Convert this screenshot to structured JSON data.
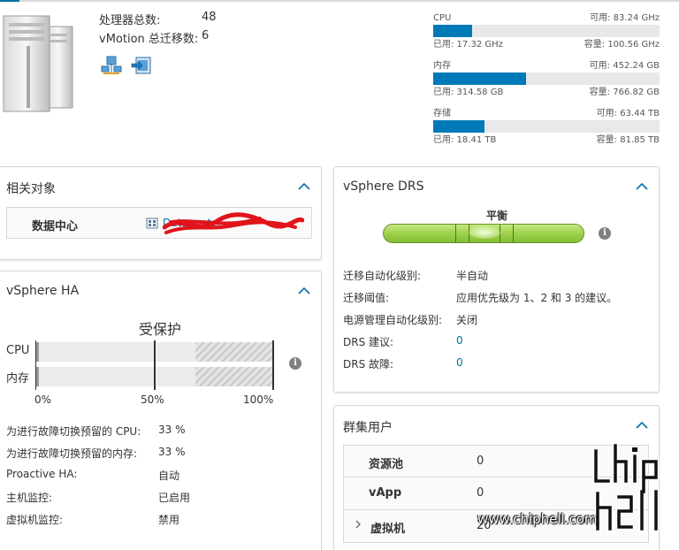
{
  "header": {
    "stats": [
      {
        "label": "处理器总数:",
        "value": "48"
      },
      {
        "label": "vMotion 总迁移数:",
        "value": "6"
      }
    ],
    "icons": [
      "network-icon",
      "migrate-icon"
    ]
  },
  "resources": [
    {
      "name": "CPU",
      "free": "可用: 83.24 GHz",
      "used": "已用: 17.32 GHz",
      "capacity": "容量: 100.56 GHz",
      "used_fraction": 0.172
    },
    {
      "name": "内存",
      "free": "可用: 452.24 GB",
      "used": "已用: 314.58 GB",
      "capacity": "容量: 766.82 GB",
      "used_fraction": 0.41
    },
    {
      "name": "存储",
      "free": "可用: 63.44 TB",
      "used": "已用: 18.41 TB",
      "capacity": "容量: 81.85 TB",
      "used_fraction": 0.225
    }
  ],
  "related": {
    "title": "相关对象",
    "key": "数据中心",
    "value": "Datacenter..."
  },
  "ha": {
    "title": "vSphere HA",
    "status": "受保护",
    "rows": [
      {
        "label": "CPU",
        "used_fraction": 0.01,
        "reserved_fraction": 0.33
      },
      {
        "label": "内存",
        "used_fraction": 0.01,
        "reserved_fraction": 0.33
      }
    ],
    "ticks": [
      "0%",
      "50%",
      "100%"
    ],
    "details": [
      {
        "k": "为进行故障切换预留的 CPU:",
        "v": "33 %"
      },
      {
        "k": "为进行故障切换预留的内存:",
        "v": "33 %"
      },
      {
        "k": "Proactive HA:",
        "v": "自动"
      },
      {
        "k": "主机监控:",
        "v": "已启用"
      },
      {
        "k": "虚拟机监控:",
        "v": "禁用"
      }
    ]
  },
  "drs": {
    "title": "vSphere DRS",
    "gauge_label": "平衡",
    "details": [
      {
        "k": "迁移自动化级别:",
        "v": "半自动",
        "link": false
      },
      {
        "k": "迁移阈值:",
        "v": "应用优先级为 1、2 和 3 的建议。",
        "link": false
      },
      {
        "k": "电源管理自动化级别:",
        "v": "关闭",
        "link": false
      },
      {
        "k": "DRS 建议:",
        "v": "0",
        "link": true
      },
      {
        "k": "DRS 故障:",
        "v": "0",
        "link": true
      }
    ]
  },
  "consumers": {
    "title": "群集用户",
    "rows": [
      {
        "k": "资源池",
        "v": "0"
      },
      {
        "k": "vApp",
        "v": "0"
      },
      {
        "k": "虚拟机",
        "v": "20"
      }
    ]
  },
  "watermark": {
    "text": "www.chiphell.com",
    "logo_text": "chiphell"
  },
  "colors": {
    "accent": "#0079b8",
    "link": "#0072a3",
    "drs_green": "#9ed14a"
  }
}
